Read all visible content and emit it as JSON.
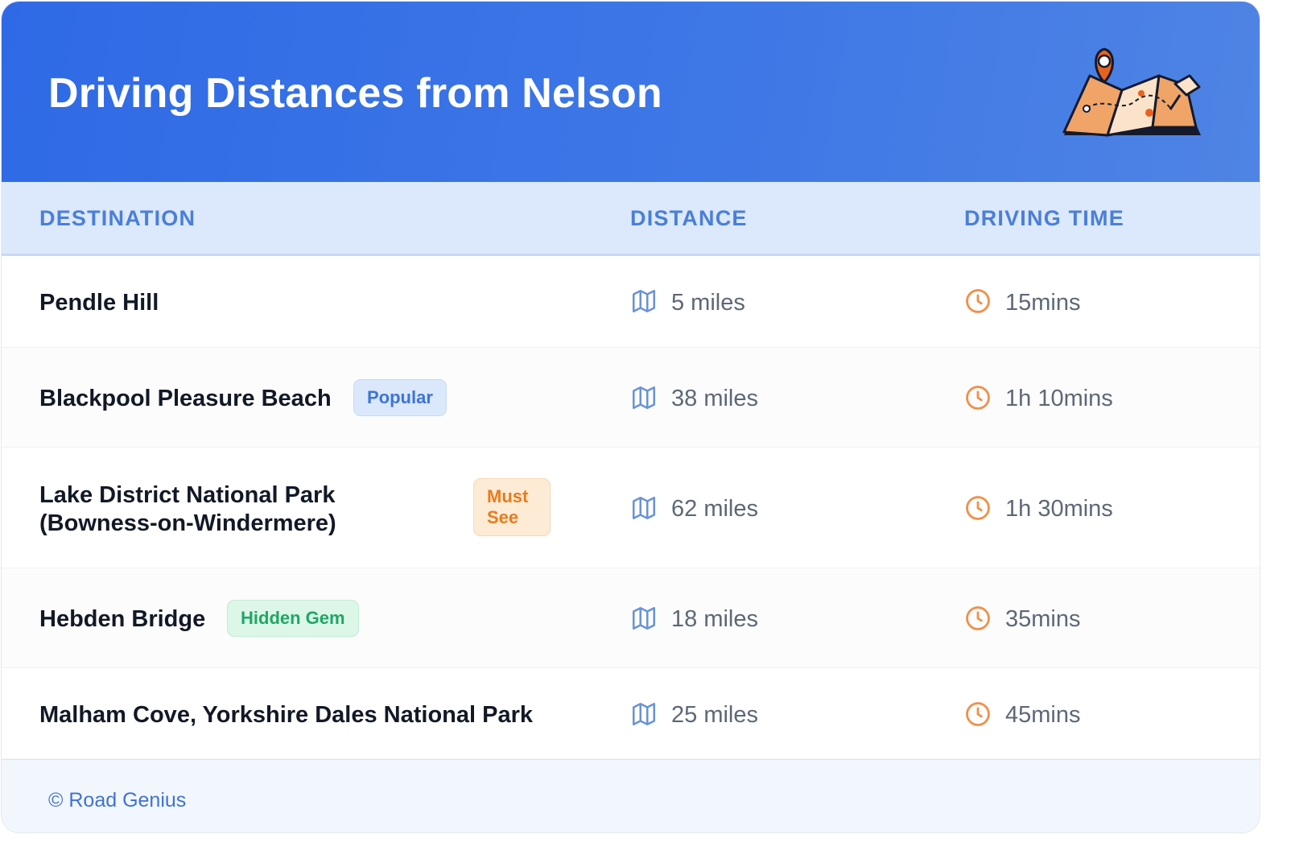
{
  "header": {
    "title": "Driving Distances from Nelson",
    "illustration_icon": "folded-map-with-pins-icon"
  },
  "columns": {
    "destination": "DESTINATION",
    "distance": "DISTANCE",
    "time": "DRIVING TIME"
  },
  "icons": {
    "distance": "map-icon",
    "time": "clock-icon"
  },
  "rows": [
    {
      "destination": "Pendle Hill",
      "badge": "",
      "distance": "5 miles",
      "time": "15mins"
    },
    {
      "destination": "Blackpool Pleasure Beach",
      "badge": "Popular",
      "distance": "38 miles",
      "time": "1h 10mins"
    },
    {
      "destination_line1": "Lake District National Park",
      "destination_line2": "(Bowness-on-Windermere)",
      "badge": "Must See",
      "distance": "62 miles",
      "time": "1h 30mins"
    },
    {
      "destination": "Hebden Bridge",
      "badge": "Hidden Gem",
      "distance": "18 miles",
      "time": "35mins"
    },
    {
      "destination": "Malham Cove, Yorkshire Dales National Park",
      "badge": "",
      "distance": "25 miles",
      "time": "45mins"
    }
  ],
  "footer": {
    "credit": "© Road Genius"
  },
  "colors": {
    "header_blue": "#2f6ae6",
    "column_header_text": "#4a7fd8",
    "popular_badge": "#3d74d6",
    "must_see_badge": "#ea7b1c",
    "hidden_gem_badge": "#1fa766",
    "distance_icon": "#6a93d6",
    "clock_icon": "#f0914a"
  }
}
